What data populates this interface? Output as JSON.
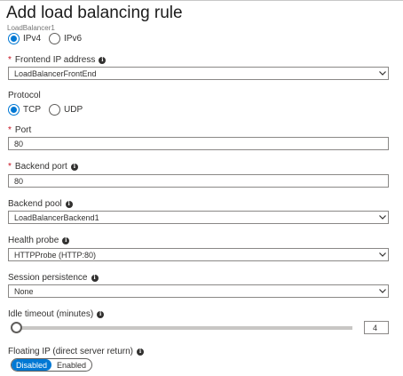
{
  "header": {
    "title": "Add load balancing rule",
    "subtitle": "LoadBalancer1"
  },
  "ip_version": {
    "options": [
      {
        "label": "IPv4",
        "selected": true
      },
      {
        "label": "IPv6",
        "selected": false
      }
    ]
  },
  "frontend_ip": {
    "label": "Frontend IP address",
    "required_marker": "*",
    "value": "LoadBalancerFrontEnd"
  },
  "protocol": {
    "label": "Protocol",
    "options": [
      {
        "label": "TCP",
        "selected": true
      },
      {
        "label": "UDP",
        "selected": false
      }
    ]
  },
  "port": {
    "label": "Port",
    "required_marker": "*",
    "value": "80"
  },
  "backend_port": {
    "label": "Backend port",
    "required_marker": "*",
    "value": "80"
  },
  "backend_pool": {
    "label": "Backend pool",
    "value": "LoadBalancerBackend1"
  },
  "health_probe": {
    "label": "Health probe",
    "value": "HTTPProbe (HTTP:80)"
  },
  "session_persistence": {
    "label": "Session persistence",
    "value": "None"
  },
  "idle_timeout": {
    "label": "Idle timeout (minutes)",
    "value": "4"
  },
  "floating_ip": {
    "label": "Floating IP (direct server return)",
    "options": [
      {
        "label": "Disabled",
        "selected": true
      },
      {
        "label": "Enabled",
        "selected": false
      }
    ]
  },
  "icons": {
    "info": "info-icon",
    "dropdown": "chevron-down-icon"
  },
  "colors": {
    "accent": "#0078d4",
    "required": "#c50f1f",
    "text": "#323130"
  }
}
